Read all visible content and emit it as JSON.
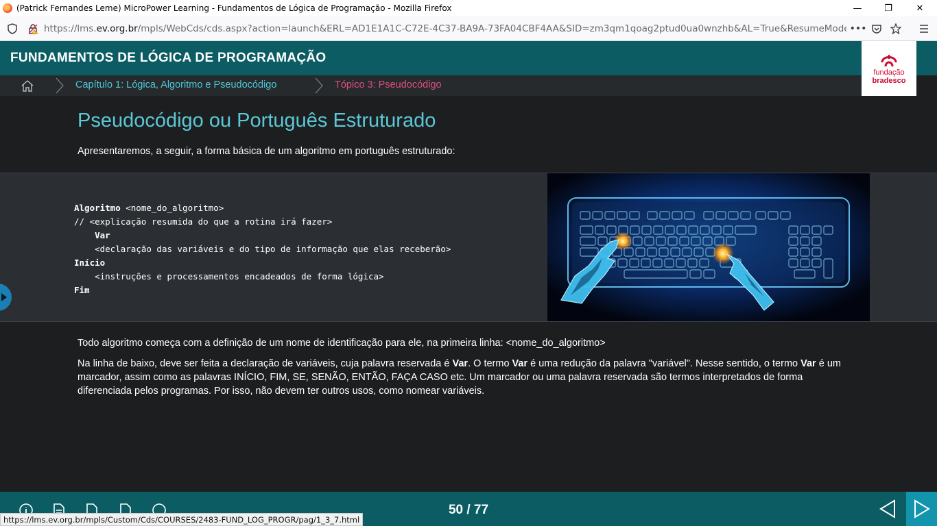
{
  "window": {
    "title": "(Patrick Fernandes Leme) MicroPower Learning - Fundamentos de Lógica de Programação - Mozilla Firefox",
    "minimize": "—",
    "restore": "❐",
    "close": "✕"
  },
  "browser": {
    "url_prefix": "https://lms.",
    "url_domain": "ev.org.br",
    "url_rest": "/mpls/WebCds/cds.aspx?action=launch&ERL=AD1E1A1C-C72E-4C37-BA9A-73FA04CBF4AA&SID=zm3qm1qoag2ptud0ua0wnzhb&AL=True&ResumeMode=CP&DCM=A",
    "more": "•••"
  },
  "course": {
    "title": "FUNDAMENTOS DE LÓGICA DE PROGRAMAÇÃO",
    "logo_line1": "fundação",
    "logo_line2": "bradesco"
  },
  "breadcrumb": {
    "chapter": "Capítulo 1: Lógica, Algoritmo e Pseudocódigo",
    "topic": "Tópico 3: Pseudocódigo"
  },
  "content": {
    "title": "Pseudocódigo ou Português Estruturado",
    "intro": "Apresentaremos, a seguir, a forma básica de um algoritmo em português estruturado:",
    "code": {
      "l1_kw": "Algoritmo",
      "l1_rest": " <nome_do_algoritmo>",
      "l2": "// <explicação resumida do que a rotina irá fazer>",
      "l3_kw": "Var",
      "l4": "<declaração das variáveis e do tipo de informação que elas receberão>",
      "l5_kw": "Início",
      "l6": "<instruções e processamentos encadeados de forma lógica>",
      "l7_kw": "Fim"
    },
    "para1": "Todo algoritmo começa com a definição de um nome de identificação para ele, na primeira linha: <nome_do_algoritmo>",
    "para2": {
      "a": "Na linha de baixo, deve ser feita a declaração de variáveis, cuja palavra reservada é ",
      "b": "Var",
      "c": ". O termo ",
      "d": "Var",
      "e": " é uma redução da palavra \"variável\". Nesse sentido, o termo ",
      "f": "Var",
      "g": " é um marcador, assim como as palavras INÍCIO, FIM, SE, SENÃO, ENTÃO, FAÇA CASO etc. Um marcador ou uma palavra reservada são termos interpretados de forma diferenciada pelos programas. Por isso, não devem ter outros usos, como nomear variáveis."
    }
  },
  "footer": {
    "pager": "50 / 77"
  },
  "status_url": "https://lms.ev.org.br/mpls/Custom/Cds/COURSES/2483-FUND_LOG_PROGR/pag/1_3_7.html",
  "colors": {
    "header_bg": "#0b5c63",
    "crumb_chapter": "#4fc7d6",
    "crumb_topic": "#e04d7a",
    "title_color": "#5bc8d6"
  }
}
